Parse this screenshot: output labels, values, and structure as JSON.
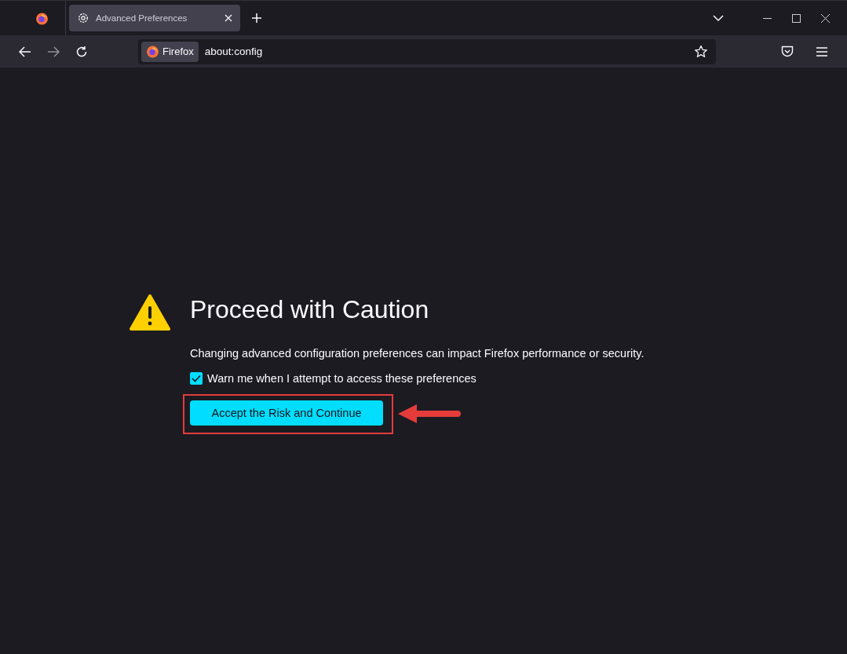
{
  "tabs": [
    {
      "label": "Advanced Preferences",
      "selected": true
    }
  ],
  "url_bar": {
    "identity": "Firefox",
    "value": "about:config"
  },
  "page": {
    "title": "Proceed with Caution",
    "description": "Changing advanced configuration preferences can impact Firefox performance or security.",
    "checkbox": {
      "label": "Warn me when I attempt to access these preferences",
      "checked": true
    },
    "button": "Accept the Risk and Continue",
    "highlighted": true
  }
}
